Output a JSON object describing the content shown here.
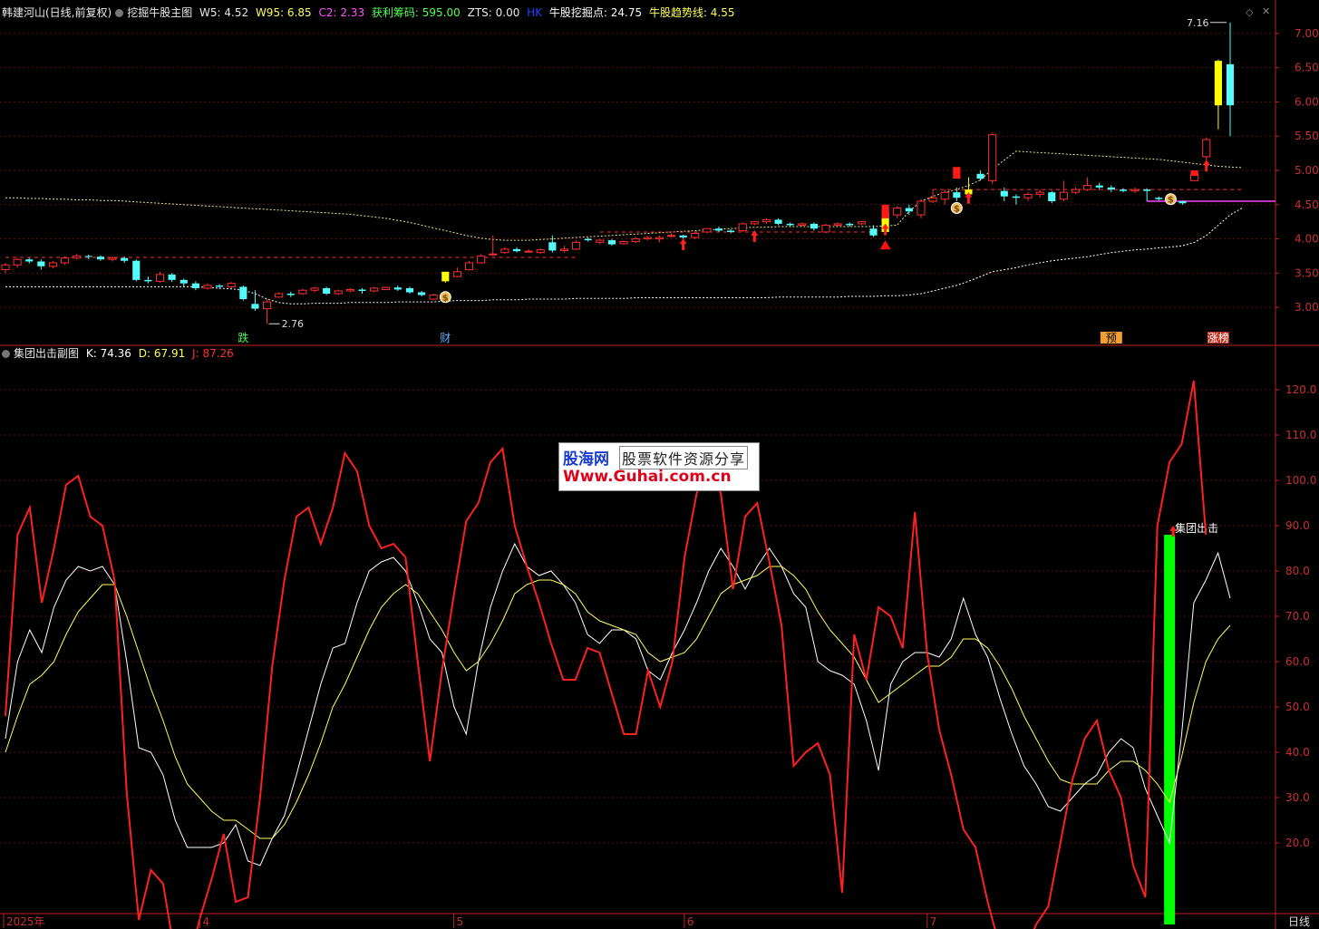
{
  "header": {
    "stock_title": "韩建河山(日线,前复权)",
    "indicator_name": "挖掘牛股主图",
    "w5": "W5: 4.52",
    "w95": "W95: 6.85",
    "c2": "C2: 2.33",
    "profit_chips": "获利筹码: 595.00",
    "zts": "ZTS: 0.00",
    "hk": "HK",
    "dig_point": "牛股挖掘点: 24.75",
    "trend_line": "牛股趋势线: 4.55"
  },
  "sub_header": {
    "indicator_name": "集团出击副图",
    "k": "K: 74.36",
    "d": "D: 67.91",
    "j": "J: 87.26"
  },
  "corner_label": "日线",
  "watermark": {
    "brand": "股海网",
    "slogan": "股票软件资源分享",
    "url": "Www.Guhai.com.cn"
  },
  "colors": {
    "background": "#000000",
    "up_candle": "#ff3030",
    "down_candle": "#54fcfc",
    "axis": "#c02020",
    "k_line": "#ffffff",
    "d_line": "#ffff60",
    "j_line": "#ff2020",
    "signal_bar": "#00ff00"
  },
  "chart_data": [
    {
      "type": "candlestick",
      "title": "挖掘牛股主图",
      "ylim": [
        2.75,
        7.25
      ],
      "yticks": [
        "7.00",
        "6.50",
        "6.00",
        "5.50",
        "5.00",
        "4.50",
        "4.00",
        "3.50",
        "3.00"
      ],
      "annotations": {
        "low": "2.76",
        "high": "7.16",
        "markers": [
          "跌",
          "财",
          "预",
          "涨榜"
        ]
      },
      "candles": [
        [
          3.55,
          3.62,
          3.65,
          3.5
        ],
        [
          3.62,
          3.7,
          3.72,
          3.58
        ],
        [
          3.7,
          3.67,
          3.72,
          3.64
        ],
        [
          3.67,
          3.6,
          3.7,
          3.55
        ],
        [
          3.6,
          3.65,
          3.68,
          3.57
        ],
        [
          3.65,
          3.72,
          3.74,
          3.62
        ],
        [
          3.72,
          3.75,
          3.78,
          3.7
        ],
        [
          3.75,
          3.74,
          3.77,
          3.7
        ],
        [
          3.74,
          3.7,
          3.76,
          3.68
        ],
        [
          3.7,
          3.72,
          3.75,
          3.67
        ],
        [
          3.72,
          3.68,
          3.74,
          3.65
        ],
        [
          3.68,
          3.4,
          3.7,
          3.38
        ],
        [
          3.4,
          3.38,
          3.45,
          3.35
        ],
        [
          3.38,
          3.48,
          3.52,
          3.36
        ],
        [
          3.48,
          3.4,
          3.5,
          3.37
        ],
        [
          3.4,
          3.35,
          3.42,
          3.3
        ],
        [
          3.35,
          3.28,
          3.38,
          3.25
        ],
        [
          3.28,
          3.32,
          3.35,
          3.26
        ],
        [
          3.32,
          3.3,
          3.34,
          3.27
        ],
        [
          3.3,
          3.35,
          3.37,
          3.28
        ],
        [
          3.3,
          3.12,
          3.32,
          3.1
        ],
        [
          3.05,
          2.98,
          3.25,
          2.95
        ],
        [
          2.98,
          3.08,
          3.12,
          2.76
        ],
        [
          3.15,
          3.2,
          3.22,
          3.14
        ],
        [
          3.2,
          3.18,
          3.23,
          3.15
        ],
        [
          3.2,
          3.25,
          3.27,
          3.18
        ],
        [
          3.25,
          3.28,
          3.3,
          3.22
        ],
        [
          3.28,
          3.2,
          3.3,
          3.18
        ],
        [
          3.2,
          3.24,
          3.26,
          3.18
        ],
        [
          3.24,
          3.26,
          3.28,
          3.22
        ],
        [
          3.26,
          3.24,
          3.28,
          3.2
        ],
        [
          3.24,
          3.28,
          3.3,
          3.22
        ],
        [
          3.26,
          3.29,
          3.3,
          3.25
        ],
        [
          3.29,
          3.26,
          3.32,
          3.24
        ],
        [
          3.28,
          3.22,
          3.3,
          3.2
        ],
        [
          3.22,
          3.18,
          3.24,
          3.16
        ],
        [
          3.12,
          3.18,
          3.2,
          3.1
        ],
        [
          3.38,
          3.52,
          3.52,
          3.36
        ],
        [
          3.45,
          3.52,
          3.58,
          3.44
        ],
        [
          3.55,
          3.65,
          3.68,
          3.54
        ],
        [
          3.65,
          3.75,
          3.78,
          3.64
        ],
        [
          3.78,
          3.78,
          4.05,
          3.75
        ],
        [
          3.8,
          3.85,
          3.88,
          3.78
        ],
        [
          3.85,
          3.82,
          3.88,
          3.8
        ],
        [
          3.82,
          3.82,
          3.85,
          3.8
        ],
        [
          3.8,
          3.84,
          3.86,
          3.78
        ],
        [
          3.95,
          3.83,
          4.05,
          3.8
        ],
        [
          3.83,
          3.85,
          3.9,
          3.8
        ],
        [
          3.85,
          3.95,
          3.98,
          3.84
        ],
        [
          4.0,
          3.98,
          4.02,
          3.96
        ],
        [
          3.95,
          3.98,
          4.0,
          3.92
        ],
        [
          3.98,
          3.92,
          4.0,
          3.9
        ],
        [
          3.93,
          3.96,
          3.98,
          3.92
        ],
        [
          3.96,
          4.0,
          4.03,
          3.94
        ],
        [
          4.0,
          4.02,
          4.04,
          3.98
        ],
        [
          4.0,
          4.02,
          4.05,
          3.95
        ],
        [
          4.05,
          4.05,
          4.08,
          4.02
        ],
        [
          4.05,
          4.02,
          4.06,
          4.0
        ],
        [
          4.02,
          4.08,
          4.1,
          4.0
        ],
        [
          4.1,
          4.15,
          4.16,
          4.08
        ],
        [
          4.15,
          4.12,
          4.18,
          4.1
        ],
        [
          4.12,
          4.1,
          4.14,
          4.08
        ],
        [
          4.12,
          4.22,
          4.24,
          4.1
        ],
        [
          4.22,
          4.25,
          4.26,
          4.2
        ],
        [
          4.25,
          4.28,
          4.3,
          4.22
        ],
        [
          4.28,
          4.22,
          4.3,
          4.2
        ],
        [
          4.22,
          4.2,
          4.24,
          4.18
        ],
        [
          4.2,
          4.22,
          4.24,
          4.18
        ],
        [
          4.22,
          4.15,
          4.24,
          4.12
        ],
        [
          4.1,
          4.2,
          4.22,
          4.08
        ],
        [
          4.2,
          4.22,
          4.24,
          4.18
        ],
        [
          4.22,
          4.2,
          4.24,
          4.18
        ],
        [
          4.22,
          4.25,
          4.26,
          4.2
        ],
        [
          4.15,
          4.05,
          4.2,
          4.03
        ],
        [
          4.1,
          4.38,
          4.4,
          4.08
        ],
        [
          4.35,
          4.45,
          4.48,
          4.3
        ],
        [
          4.45,
          4.4,
          4.5,
          4.35
        ],
        [
          4.35,
          4.55,
          4.58,
          4.3
        ],
        [
          4.55,
          4.6,
          4.72,
          4.52
        ],
        [
          4.58,
          4.68,
          4.72,
          4.5
        ],
        [
          4.68,
          4.6,
          4.75,
          4.55
        ],
        [
          4.65,
          4.72,
          4.9,
          4.6
        ],
        [
          4.95,
          4.88,
          5.0,
          4.85
        ],
        [
          4.85,
          5.52,
          5.55,
          4.8
        ],
        [
          4.7,
          4.62,
          4.75,
          4.55
        ],
        [
          4.62,
          4.6,
          4.65,
          4.5
        ],
        [
          4.6,
          4.65,
          4.68,
          4.55
        ],
        [
          4.65,
          4.68,
          4.72,
          4.6
        ],
        [
          4.68,
          4.55,
          4.7,
          4.52
        ],
        [
          4.58,
          4.68,
          4.85,
          4.55
        ],
        [
          4.68,
          4.72,
          4.75,
          4.65
        ],
        [
          4.72,
          4.78,
          4.9,
          4.7
        ],
        [
          4.78,
          4.75,
          4.82,
          4.72
        ],
        [
          4.75,
          4.72,
          4.78,
          4.68
        ],
        [
          4.72,
          4.7,
          4.74,
          4.68
        ],
        [
          4.7,
          4.72,
          4.75,
          4.67
        ],
        [
          4.72,
          4.7,
          4.74,
          4.55
        ],
        [
          4.6,
          4.58,
          4.62,
          4.56
        ],
        [
          4.58,
          4.55,
          4.6,
          4.53
        ],
        [
          4.55,
          4.52,
          4.56,
          4.5
        ],
        [
          4.85,
          4.95,
          5.0,
          4.85
        ],
        [
          5.2,
          5.45,
          5.48,
          5.15
        ],
        [
          5.95,
          6.6,
          6.62,
          5.6
        ],
        [
          6.55,
          5.95,
          7.16,
          5.5
        ]
      ],
      "ma_upper": [
        4.6,
        4.6,
        4.59,
        4.59,
        4.58,
        4.58,
        4.57,
        4.57,
        4.56,
        4.56,
        4.55,
        4.54,
        4.53,
        4.52,
        4.51,
        4.5,
        4.49,
        4.48,
        4.47,
        4.46,
        4.45,
        4.44,
        4.43,
        4.42,
        4.41,
        4.4,
        4.39,
        4.38,
        4.37,
        4.36,
        4.34,
        4.32,
        4.3,
        4.27,
        4.24,
        4.2,
        4.16,
        4.12,
        4.08,
        4.04,
        4.01,
        3.99,
        3.98,
        3.98,
        3.98,
        3.99,
        4.0,
        4.01,
        4.02,
        4.03,
        4.04,
        4.05,
        4.06,
        4.07,
        4.08,
        4.09,
        4.1,
        4.11,
        4.12,
        4.13,
        4.14,
        4.15,
        4.16,
        4.17,
        4.17,
        4.18,
        4.18,
        4.18,
        4.18,
        4.18,
        4.18,
        4.18,
        4.18,
        4.18,
        4.19,
        4.2,
        4.4,
        4.55,
        4.62,
        4.68,
        4.72,
        4.78,
        4.86,
        5.02,
        5.15,
        5.28,
        5.27,
        5.26,
        5.25,
        5.24,
        5.23,
        5.22,
        5.21,
        5.2,
        5.19,
        5.18,
        5.17,
        5.16,
        5.14,
        5.12,
        5.1,
        5.08,
        5.06,
        5.05,
        5.04
      ],
      "ma_lower": [
        3.3,
        3.3,
        3.3,
        3.3,
        3.3,
        3.3,
        3.3,
        3.3,
        3.3,
        3.3,
        3.3,
        3.3,
        3.3,
        3.3,
        3.3,
        3.3,
        3.3,
        3.29,
        3.28,
        3.27,
        3.25,
        3.2,
        3.12,
        3.07,
        3.05,
        3.05,
        3.06,
        3.06,
        3.06,
        3.07,
        3.07,
        3.07,
        3.07,
        3.08,
        3.08,
        3.08,
        3.08,
        3.09,
        3.1,
        3.1,
        3.1,
        3.11,
        3.11,
        3.11,
        3.12,
        3.12,
        3.12,
        3.12,
        3.13,
        3.13,
        3.13,
        3.13,
        3.13,
        3.14,
        3.14,
        3.14,
        3.14,
        3.14,
        3.14,
        3.14,
        3.14,
        3.14,
        3.14,
        3.14,
        3.14,
        3.15,
        3.15,
        3.15,
        3.15,
        3.15,
        3.15,
        3.16,
        3.16,
        3.16,
        3.17,
        3.17,
        3.18,
        3.2,
        3.24,
        3.28,
        3.32,
        3.38,
        3.45,
        3.52,
        3.55,
        3.58,
        3.62,
        3.65,
        3.68,
        3.7,
        3.72,
        3.74,
        3.77,
        3.8,
        3.82,
        3.84,
        3.85,
        3.87,
        3.88,
        3.9,
        3.95,
        4.05,
        4.2,
        4.35,
        4.45
      ],
      "resistance": [
        {
          "x0": 0,
          "x1": 24,
          "y": 3.73
        },
        {
          "x0": 22,
          "x1": 48,
          "y": 3.73
        },
        {
          "x0": 50,
          "x1": 73,
          "y": 4.1
        },
        {
          "x0": 78,
          "x1": 104,
          "y": 4.72
        }
      ],
      "trend_line_value": 4.55
    },
    {
      "type": "line",
      "title": "集团出击副图",
      "ylim": [
        5,
        127
      ],
      "yticks": [
        "120.0",
        "110.0",
        "100.0",
        "90.0",
        "80.0",
        "70.0",
        "60.0",
        "50.0",
        "40.0",
        "30.0",
        "20.0"
      ],
      "x_labels": [
        "2025年",
        "4",
        "5",
        "6",
        "7"
      ],
      "signal_label": "集团出击",
      "series": [
        {
          "name": "K",
          "values": [
            43,
            60,
            67,
            62,
            72,
            78,
            81,
            80,
            81,
            77,
            60,
            41,
            40,
            35,
            25,
            19,
            19,
            19,
            20,
            24,
            16,
            15,
            21,
            26,
            35,
            45,
            55,
            63,
            64,
            73,
            80,
            82,
            83,
            80,
            73,
            65,
            62,
            50,
            44,
            60,
            72,
            80,
            86,
            81,
            79,
            80,
            77,
            73,
            66,
            64,
            67,
            67,
            65,
            58,
            56,
            62,
            67,
            73,
            80,
            85,
            81,
            76,
            81,
            85,
            81,
            75,
            72,
            60,
            58,
            57,
            55,
            47,
            36,
            55,
            60,
            62,
            62,
            61,
            65,
            74,
            66,
            61,
            52,
            44,
            37,
            33,
            28,
            27,
            30,
            33,
            35,
            40,
            43,
            41,
            32,
            26,
            20,
            44,
            73,
            78,
            84,
            74
          ]
        },
        {
          "name": "D",
          "values": [
            40,
            48,
            55,
            57,
            60,
            66,
            71,
            74,
            77,
            77,
            70,
            62,
            54,
            47,
            39,
            33,
            30,
            27,
            25,
            25,
            23,
            21,
            21,
            24,
            29,
            35,
            42,
            50,
            55,
            61,
            67,
            72,
            75,
            77,
            75,
            71,
            67,
            62,
            58,
            60,
            64,
            69,
            75,
            77,
            78,
            78,
            77,
            75,
            71,
            69,
            68,
            67,
            66,
            62,
            60,
            61,
            62,
            65,
            70,
            75,
            77,
            78,
            79,
            81,
            81,
            79,
            76,
            71,
            67,
            64,
            61,
            56,
            51,
            53,
            55,
            57,
            59,
            59,
            61,
            65,
            65,
            63,
            59,
            54,
            48,
            43,
            38,
            34,
            33,
            33,
            33,
            36,
            38,
            38,
            36,
            33,
            29,
            39,
            51,
            60,
            65,
            68
          ]
        },
        {
          "name": "J",
          "values": [
            48,
            88,
            94,
            73,
            85,
            99,
            101,
            92,
            90,
            78,
            31,
            3,
            14,
            11,
            -5,
            -8,
            3,
            12,
            22,
            7,
            8,
            30,
            59,
            78,
            92,
            94,
            86,
            94,
            106,
            102,
            90,
            85,
            86,
            83,
            60,
            38,
            58,
            75,
            91,
            95,
            104,
            107,
            90,
            81,
            73,
            64,
            56,
            56,
            63,
            62,
            53,
            44,
            44,
            58,
            50,
            60,
            83,
            97,
            106,
            97,
            76,
            92,
            95,
            82,
            68,
            37,
            40,
            42,
            35,
            9,
            66,
            56,
            72,
            70,
            63,
            93,
            62,
            45,
            35,
            23,
            19,
            7,
            -3,
            -7,
            -5,
            2,
            6,
            20,
            34,
            43,
            47,
            36,
            30,
            15,
            8,
            90,
            104,
            108,
            122,
            88
          ]
        }
      ]
    }
  ]
}
